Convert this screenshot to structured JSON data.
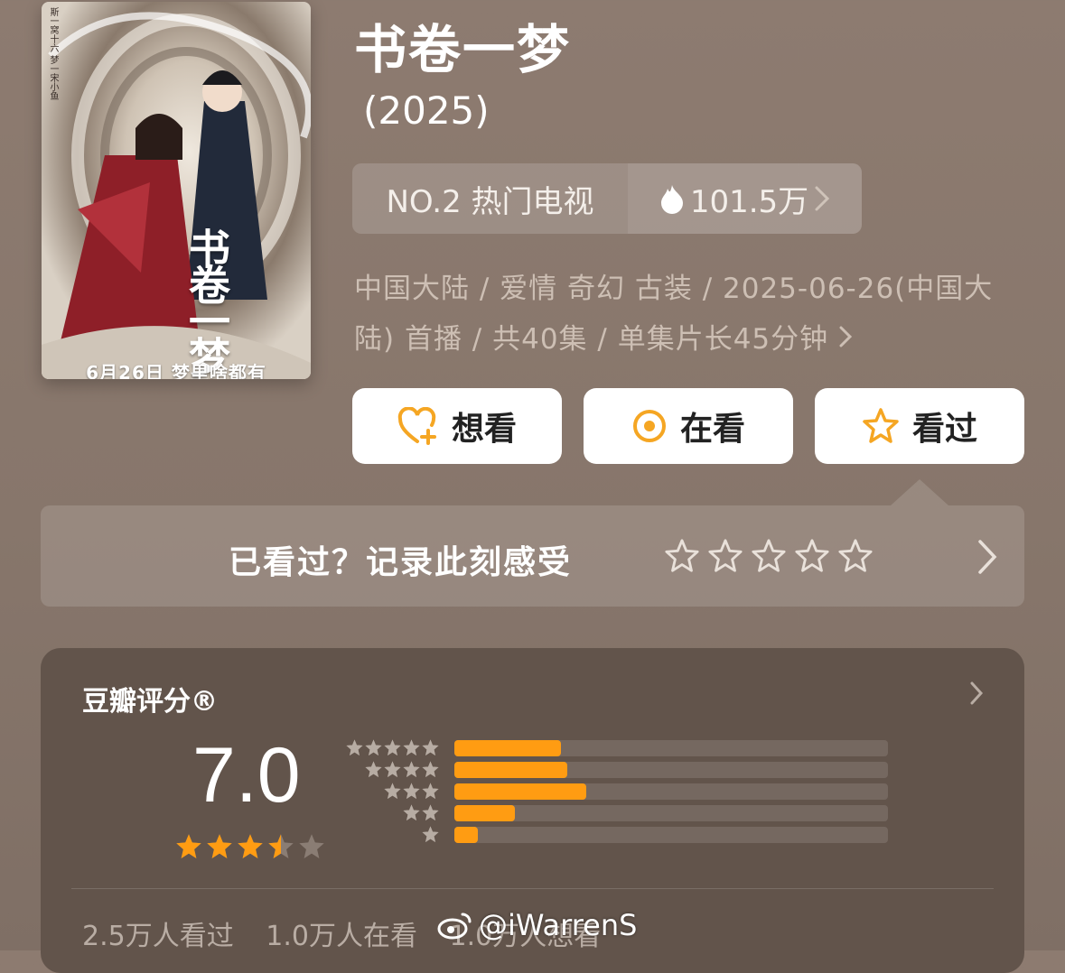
{
  "poster": {
    "caption": "6月26日 梦里啥都有",
    "side_text": "斯一窝十六 梦一宋小鱼",
    "calligraphy": "书卷一梦"
  },
  "title": "书卷一梦",
  "year": "(2025)",
  "ranking": {
    "label": "NO.2 热门电视",
    "heat": "101.5万"
  },
  "meta": {
    "line": "中国大陆 / 爱情 奇幻 古装 / 2025-06-26(中国大陆) 首播 / 共40集 / 单集片长45分钟"
  },
  "actions": {
    "want": "想看",
    "watching": "在看",
    "watched": "看过"
  },
  "record": {
    "prompt": "已看过？记录此刻感受"
  },
  "rating": {
    "title": "豆瓣评分®",
    "score": "7.0",
    "stars_value": 3.5,
    "distribution_fraction": [
      0.245,
      0.26,
      0.305,
      0.14,
      0.055
    ],
    "watched": "2.5万人看过",
    "watching": "1.0万人在看",
    "want": "1.0万人想看"
  },
  "watermark": "@iWarrenS",
  "colors": {
    "accent_orange": "#ff9c12",
    "star_orange": "#f5a623",
    "card_bg": "#62544b"
  }
}
